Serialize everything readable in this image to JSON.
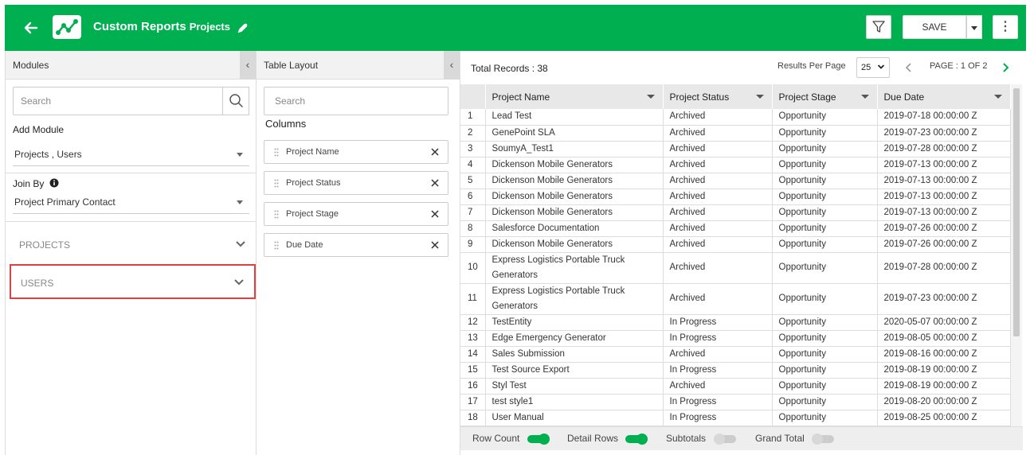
{
  "header": {
    "title": "Custom Reports",
    "subtitle": "Projects",
    "save_label": "SAVE",
    "more_label": "⋮",
    "brand_color": "#00b050"
  },
  "modules": {
    "title": "Modules",
    "collapse_glyph": "‹",
    "search_placeholder": "Search",
    "add_module_label": "Add Module",
    "add_module_value": "Projects , Users",
    "join_by_label": "Join By",
    "join_by_value": "Project Primary Contact",
    "accordions": [
      {
        "label": "PROJECTS"
      },
      {
        "label": "USERS"
      }
    ]
  },
  "layout": {
    "title": "Table Layout",
    "collapse_glyph": "‹",
    "search_placeholder": "Search",
    "columns_label": "Columns",
    "columns": [
      "Project Name",
      "Project Status",
      "Project Stage",
      "Due Date"
    ]
  },
  "results": {
    "total_label": "Total Records : 38",
    "results_per_page_label": "Results Per Page",
    "results_per_page_value": "25",
    "page_label": "PAGE : 1 OF 2",
    "headers": [
      "Project Name",
      "Project Status",
      "Project Stage",
      "Due Date"
    ],
    "rows": [
      [
        "1",
        "Lead Test",
        "Archived",
        "Opportunity",
        "2019-07-18 00:00:00 Z"
      ],
      [
        "2",
        "GenePoint SLA",
        "Archived",
        "Opportunity",
        "2019-07-23 00:00:00 Z"
      ],
      [
        "3",
        "SoumyA_Test1",
        "Archived",
        "Opportunity",
        "2019-07-28 00:00:00 Z"
      ],
      [
        "4",
        "Dickenson Mobile Generators",
        "Archived",
        "Opportunity",
        "2019-07-13 00:00:00 Z"
      ],
      [
        "5",
        "Dickenson Mobile Generators",
        "Archived",
        "Opportunity",
        "2019-07-13 00:00:00 Z"
      ],
      [
        "6",
        "Dickenson Mobile Generators",
        "Archived",
        "Opportunity",
        "2019-07-13 00:00:00 Z"
      ],
      [
        "7",
        "Dickenson Mobile Generators",
        "Archived",
        "Opportunity",
        "2019-07-13 00:00:00 Z"
      ],
      [
        "8",
        "Salesforce Documentation",
        "Archived",
        "Opportunity",
        "2019-07-26 00:00:00 Z"
      ],
      [
        "9",
        "Dickenson Mobile Generators",
        "Archived",
        "Opportunity",
        "2019-07-26 00:00:00 Z"
      ],
      [
        "10",
        "Express Logistics Portable Truck Generators",
        "Archived",
        "Opportunity",
        "2019-07-28 00:00:00 Z"
      ],
      [
        "11",
        "Express Logistics Portable Truck Generators",
        "Archived",
        "Opportunity",
        "2019-07-23 00:00:00 Z"
      ],
      [
        "12",
        "TestEntity",
        "In Progress",
        "Opportunity",
        "2020-05-07 00:00:00 Z"
      ],
      [
        "13",
        "Edge Emergency Generator",
        "In Progress",
        "Opportunity",
        "2019-08-05 00:00:00 Z"
      ],
      [
        "14",
        "Sales Submission",
        "Archived",
        "Opportunity",
        "2019-08-16 00:00:00 Z"
      ],
      [
        "15",
        "Test Source Export",
        "In Progress",
        "Opportunity",
        "2019-08-19 00:00:00 Z"
      ],
      [
        "16",
        "Styl Test",
        "Archived",
        "Opportunity",
        "2019-08-19 00:00:00 Z"
      ],
      [
        "17",
        "test style1",
        "In Progress",
        "Opportunity",
        "2019-08-20 00:00:00 Z"
      ],
      [
        "18",
        "User Manual",
        "In Progress",
        "Opportunity",
        "2019-08-25 00:00:00 Z"
      ]
    ]
  },
  "footer": {
    "row_count_label": "Row Count",
    "row_count_on": true,
    "detail_rows_label": "Detail Rows",
    "detail_rows_on": true,
    "subtotals_label": "Subtotals",
    "subtotals_on": false,
    "grand_total_label": "Grand Total",
    "grand_total_on": false
  }
}
